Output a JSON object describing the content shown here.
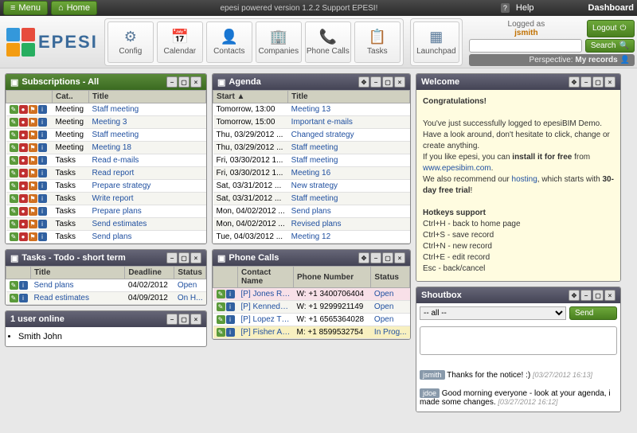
{
  "topbar": {
    "menu": "Menu",
    "home": "Home",
    "version": "epesi powered version 1.2.2  Support EPESI!",
    "help": "Help",
    "dashboard": "Dashboard"
  },
  "header": {
    "logo": "EPESI",
    "tools": [
      {
        "icon": "⚙",
        "label": "Config"
      },
      {
        "icon": "📅",
        "label": "Calendar"
      },
      {
        "icon": "👤",
        "label": "Contacts"
      },
      {
        "icon": "🏢",
        "label": "Companies"
      },
      {
        "icon": "📞",
        "label": "Phone Calls"
      },
      {
        "icon": "📋",
        "label": "Tasks"
      }
    ],
    "launchpad": {
      "icon": "▦",
      "label": "Launchpad"
    },
    "logged_as": "Logged as",
    "username": "jsmith",
    "logout": "Logout",
    "search": "Search",
    "perspective_label": "Perspective:",
    "perspective": "My records"
  },
  "subscriptions": {
    "title": "Subscriptions - All",
    "cols": [
      "",
      "Cat..",
      "Title"
    ],
    "rows": [
      {
        "cat": "Meeting",
        "title": "Staff meeting"
      },
      {
        "cat": "Meeting",
        "title": "Meeting 3"
      },
      {
        "cat": "Meeting",
        "title": "Staff meeting"
      },
      {
        "cat": "Meeting",
        "title": "Meeting 18"
      },
      {
        "cat": "Tasks",
        "title": "Read e-mails"
      },
      {
        "cat": "Tasks",
        "title": "Read report"
      },
      {
        "cat": "Tasks",
        "title": "Prepare strategy"
      },
      {
        "cat": "Tasks",
        "title": "Write report"
      },
      {
        "cat": "Tasks",
        "title": "Prepare plans"
      },
      {
        "cat": "Tasks",
        "title": "Send estimates"
      },
      {
        "cat": "Tasks",
        "title": "Send plans"
      }
    ]
  },
  "tasks": {
    "title": "Tasks - Todo - short term",
    "cols": [
      "",
      "Title",
      "Deadline",
      "Status"
    ],
    "rows": [
      {
        "title": "Send plans",
        "deadline": "04/02/2012",
        "status": "Open"
      },
      {
        "title": "Read estimates",
        "deadline": "04/09/2012",
        "status": "On H..."
      }
    ]
  },
  "users_online": {
    "title": "1 user online",
    "items": [
      "Smith John"
    ]
  },
  "agenda": {
    "title": "Agenda",
    "cols": [
      "Start ▲",
      "Title"
    ],
    "rows": [
      {
        "start": "Tomorrow, 13:00",
        "title": "Meeting 13"
      },
      {
        "start": "Tomorrow, 15:00",
        "title": "Important e-mails"
      },
      {
        "start": "Thu, 03/29/2012 ...",
        "title": "Changed strategy"
      },
      {
        "start": "Thu, 03/29/2012 ...",
        "title": "Staff meeting"
      },
      {
        "start": "Fri, 03/30/2012 1...",
        "title": "Staff meeting"
      },
      {
        "start": "Fri, 03/30/2012 1...",
        "title": "Meeting 16"
      },
      {
        "start": "Sat, 03/31/2012 ...",
        "title": "New strategy"
      },
      {
        "start": "Sat, 03/31/2012 ...",
        "title": "Staff meeting"
      },
      {
        "start": "Mon, 04/02/2012 ...",
        "title": "Send plans"
      },
      {
        "start": "Mon, 04/02/2012 ...",
        "title": "Revised plans"
      },
      {
        "start": "Tue, 04/03/2012 ...",
        "title": "Meeting 12"
      }
    ]
  },
  "phones": {
    "title": "Phone Calls",
    "cols": [
      "",
      "Contact Name",
      "Phone Number",
      "Status"
    ],
    "rows": [
      {
        "name": "[P] Jones Robe...",
        "num": "W: +1 3400706404",
        "status": "Open",
        "cls": "row-pink"
      },
      {
        "name": "[P] Kennedy Sh...",
        "num": "W: +1 9299921149",
        "status": "Open",
        "cls": ""
      },
      {
        "name": "[P] Lopez Thom...",
        "num": "W: +1 6565364028",
        "status": "Open",
        "cls": ""
      },
      {
        "name": "[P] Fisher Andr...",
        "num": "M: +1 8599532754",
        "status": "In Prog...",
        "cls": "row-yellow"
      }
    ]
  },
  "welcome": {
    "title": "Welcome",
    "h": "Congratulations!",
    "p1a": "You've just successfully logged to epesiBIM Demo. Have a look around, don't hesitate to click, change or create anything.",
    "p1b": "If you like epesi, you can ",
    "p1c": "install it for free",
    "p1d": " from ",
    "p1e": "www.epesibim.com",
    "p1f": ".",
    "p2a": "We also recommend our ",
    "p2b": "hosting",
    "p2c": ", which starts with ",
    "p2d": "30-day free trial",
    "p2e": "!",
    "hk": "Hotkeys support",
    "hk1": "Ctrl+H - back to home page",
    "hk2": "Ctrl+S - save record",
    "hk3": "Ctrl+N - new record",
    "hk4": "Ctrl+E - edit record",
    "hk5": "Esc - back/cancel"
  },
  "shoutbox": {
    "title": "Shoutbox",
    "all": "-- all --",
    "send": "Send",
    "msgs": [
      {
        "user": "jsmith",
        "text": "Thanks for the notice! :)",
        "time": "[03/27/2012 16:13]"
      },
      {
        "user": "jdoe",
        "text": "Good morning everyone - look at your agenda, i made some changes.",
        "time": "[03/27/2012 16:12]"
      }
    ]
  }
}
